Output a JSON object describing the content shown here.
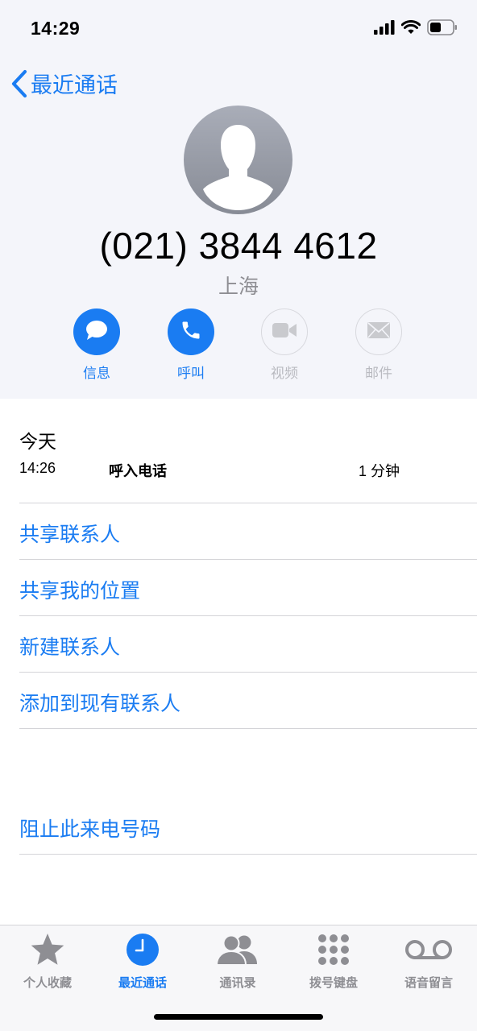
{
  "status": {
    "time": "14:29"
  },
  "nav": {
    "back_label": "最近通话"
  },
  "contact": {
    "number": "(021) 3844 4612",
    "location": "上海"
  },
  "actions": [
    {
      "label": "信息",
      "icon": "message-icon",
      "enabled": true
    },
    {
      "label": "呼叫",
      "icon": "phone-icon",
      "enabled": true
    },
    {
      "label": "视频",
      "icon": "video-icon",
      "enabled": false
    },
    {
      "label": "邮件",
      "icon": "mail-icon",
      "enabled": false
    }
  ],
  "history": {
    "day": "今天",
    "entry": {
      "time": "14:26",
      "type": "呼入电话",
      "duration": "1 分钟"
    }
  },
  "options": [
    "共享联系人",
    "共享我的位置",
    "新建联系人",
    "添加到现有联系人"
  ],
  "block": "阻止此来电号码",
  "tabs": [
    {
      "label": "个人收藏",
      "icon": "star-icon",
      "selected": false
    },
    {
      "label": "最近通话",
      "icon": "clock-icon",
      "selected": true
    },
    {
      "label": "通讯录",
      "icon": "contacts-icon",
      "selected": false
    },
    {
      "label": "拨号键盘",
      "icon": "keypad-icon",
      "selected": false
    },
    {
      "label": "语音留言",
      "icon": "voicemail-icon",
      "selected": false
    }
  ],
  "colors": {
    "accent": "#1a7cf2",
    "disabled": "#b9bac0",
    "header_bg": "#f4f5fa"
  }
}
